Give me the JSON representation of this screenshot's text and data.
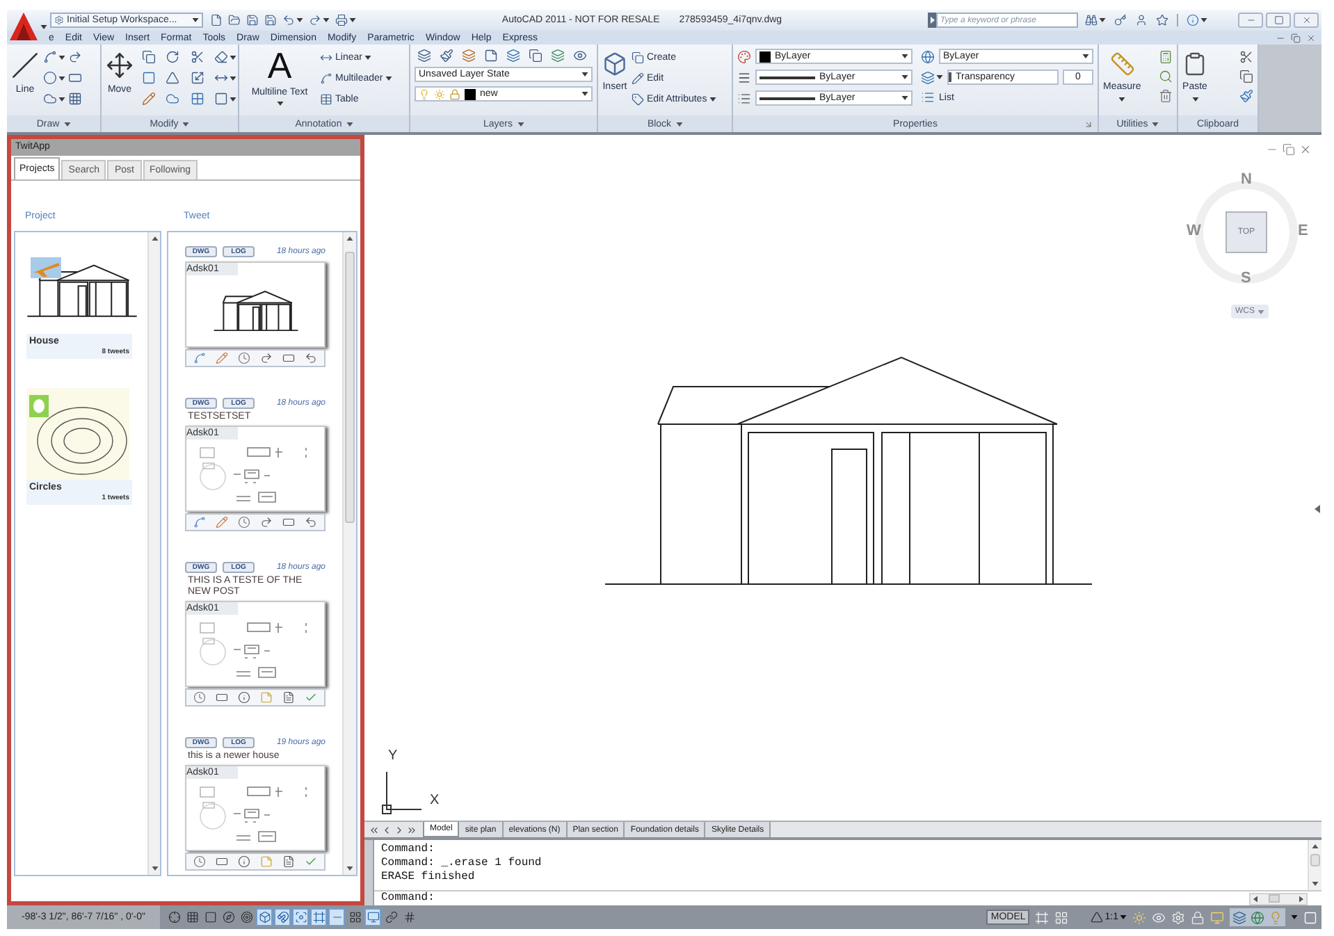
{
  "title_bar": {
    "workspace": "Initial Setup Workspace...",
    "title": "AutoCAD 2011 - NOT FOR RESALE",
    "file_name": "278593459_4i7qnv.dwg",
    "search": {
      "placeholder": "Type a keyword or phrase"
    }
  },
  "menu_bar": [
    "e",
    "Edit",
    "View",
    "Insert",
    "Format",
    "Tools",
    "Draw",
    "Dimension",
    "Modify",
    "Parametric",
    "Window",
    "Help",
    "Express"
  ],
  "ribbon": {
    "draw": {
      "title": "Draw",
      "line": "Line"
    },
    "modify": {
      "title": "Modify",
      "move": "Move"
    },
    "annotation": {
      "title": "Annotation",
      "glyph": "A",
      "text": "Multiline Text",
      "tools": [
        {
          "label": "Linear",
          "dropdown": true
        },
        {
          "label": "Multileader",
          "dropdown": true
        },
        {
          "label": "Table",
          "dropdown": false
        }
      ]
    },
    "layers": {
      "title": "Layers",
      "layer_state": "Unsaved Layer State",
      "layer": "new"
    },
    "block": {
      "title": "Block",
      "insert": "Insert",
      "tools": [
        {
          "label": "Create",
          "dropdown": false
        },
        {
          "label": "Edit",
          "dropdown": false
        },
        {
          "label": "Edit Attributes",
          "dropdown": true
        }
      ]
    },
    "properties": {
      "title": "Properties",
      "object_color": "ByLayer",
      "lineweight": "ByLayer",
      "linetype": "ByLayer",
      "plot_style": "ByLayer",
      "transparency": {
        "label": "Transparency",
        "value": "0",
        "level": 0
      },
      "list": "List"
    },
    "utilities": {
      "title": "Utilities",
      "measure": "Measure"
    },
    "clipboard": {
      "title": "Clipboard",
      "paste": "Paste"
    }
  },
  "twitapp": {
    "title": "TwitApp",
    "tabs": [
      {
        "label": "Projects",
        "selected": true
      },
      {
        "label": "Search",
        "selected": false
      },
      {
        "label": "Post",
        "selected": false
      },
      {
        "label": "Following",
        "selected": false
      }
    ],
    "project_heading": "Project",
    "tweet_heading": "Tweet",
    "projects": [
      {
        "name": "House",
        "count": "8 tweets",
        "kind": "house"
      },
      {
        "name": "Circles",
        "count": "1 tweets",
        "kind": "circles"
      }
    ],
    "tweets": [
      {
        "buttons": [
          "DWG",
          "LOG"
        ],
        "time": "18 hours ago",
        "author": "Adsk01",
        "kind": "house"
      },
      {
        "buttons": [
          "DWG",
          "LOG"
        ],
        "time": "18 hours ago",
        "message": "TESTSETSET",
        "author": "Adsk01",
        "kind": "sketch"
      },
      {
        "buttons": [
          "DWG",
          "LOG"
        ],
        "time": "18 hours ago",
        "message": "THIS IS A TESTE OF THE NEW POST",
        "author": "Adsk01",
        "kind": "review"
      },
      {
        "buttons": [
          "DWG",
          "LOG"
        ],
        "time": "19 hours ago",
        "message": "this is a newer house",
        "author": "Adsk01",
        "kind": "review"
      }
    ]
  },
  "drawing": {
    "viewcube": {
      "north": "N",
      "south": "S",
      "east": "E",
      "west": "W",
      "face": "TOP",
      "ucs": "WCS"
    },
    "axes": {
      "x": "X",
      "y": "Y"
    },
    "layout_tabs": [
      {
        "label": "Model",
        "selected": true
      },
      {
        "label": "site plan",
        "selected": false
      },
      {
        "label": "elevations (N)",
        "selected": false
      },
      {
        "label": "Plan section",
        "selected": false
      },
      {
        "label": "Foundation details",
        "selected": false
      },
      {
        "label": "Skylite Details",
        "selected": false
      }
    ]
  },
  "command_line": {
    "history": [
      "Command:",
      "Command: _.erase 1 found",
      "ERASE finished"
    ],
    "prompt": "Command:"
  },
  "status_bar": {
    "coordinates": "-98'-3 1/2\", 86'-7 7/16\" , 0'-0\"",
    "toggles": [
      {
        "on": false
      },
      {
        "on": false
      },
      {
        "on": false
      },
      {
        "on": false
      },
      {
        "on": false
      },
      {
        "on": true
      },
      {
        "on": true
      },
      {
        "on": true
      },
      {
        "on": true
      },
      {
        "on": true
      },
      {
        "on": false
      },
      {
        "on": true
      },
      {
        "on": false
      },
      {
        "on": false
      }
    ],
    "space": "MODEL",
    "annotation_scale": "1:1"
  }
}
